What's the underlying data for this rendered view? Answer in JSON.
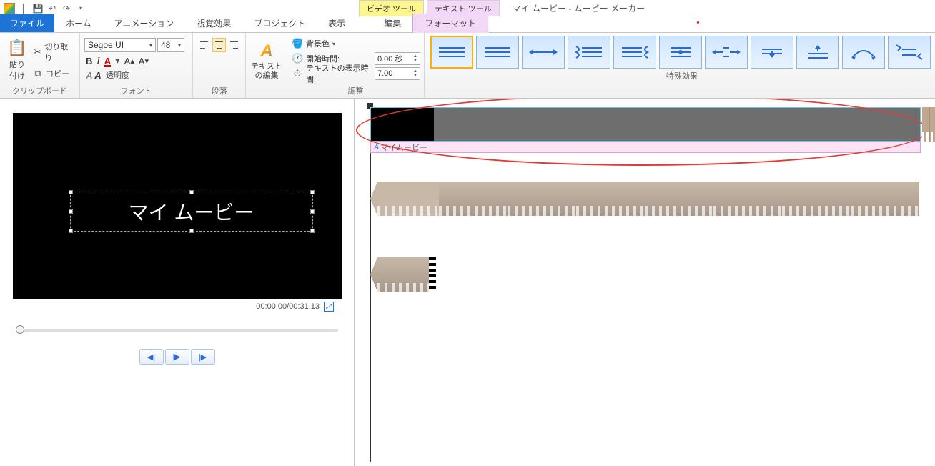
{
  "window": {
    "title": "マイ ムービー - ムービー メーカー",
    "context_tabs": {
      "video": "ビデオ ツール",
      "text": "テキスト ツール"
    }
  },
  "tabs": {
    "file": "ファイル",
    "home": "ホーム",
    "animation": "アニメーション",
    "visual": "視覚効果",
    "project": "プロジェクト",
    "view": "表示",
    "edit": "編集",
    "format": "フォーマット"
  },
  "ribbon": {
    "clipboard": {
      "paste": "貼り\n付け",
      "cut": "切り取り",
      "copy": "コピー",
      "label": "クリップボード"
    },
    "font": {
      "name": "Segoe UI",
      "size": "48",
      "transparency": "透明度",
      "label": "フォント"
    },
    "paragraph": {
      "label": "段落"
    },
    "textedit": {
      "btn": "テキスト\nの編集"
    },
    "adjust": {
      "bgcolor": "背景色",
      "start": "開始時間:",
      "start_val": "0.00 秒",
      "duration": "テキストの表示時間:",
      "duration_val": "7.00",
      "label": "調整"
    },
    "effects": {
      "label": "特殊効果"
    }
  },
  "preview": {
    "title_text": "マイ ムービー",
    "time": "00:00.00/00:31.13"
  },
  "timeline": {
    "text_track_label": "マイムービー"
  }
}
